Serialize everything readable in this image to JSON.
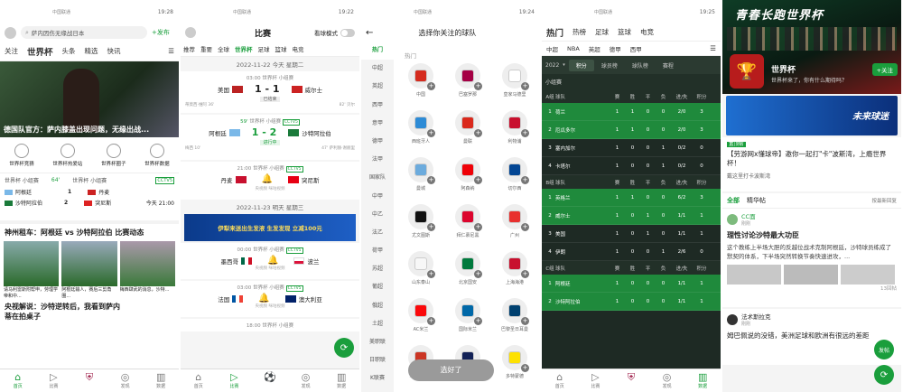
{
  "p1": {
    "carrier": "中国联通",
    "time": "19:28",
    "search": "萨内因伤无缘战日本",
    "publish": "+发布",
    "tabs": [
      "关注",
      "世界杯",
      "头条",
      "精选",
      "快讯"
    ],
    "hero": "德国队官方：萨内膝盖出现问题，无缘出战...",
    "tiles": [
      "世界杯竞猜",
      "世界杯热爱站",
      "世界杯圈子",
      "世界杯数据"
    ],
    "match": {
      "league": "世界杯 小组赛",
      "min": "64'",
      "tv": "CCTV5",
      "t1": "阿根廷",
      "s1": "1",
      "t2": "沙特阿拉伯",
      "s2": "2",
      "league2": "世界杯 小组赛",
      "t3": "丹麦",
      "t4": "突尼斯",
      "day": "今天",
      "kick": "21:00"
    },
    "sec": "神州租车：阿根廷 vs 沙特阿拉伯 比赛动态",
    "cards": [
      "请马利雷斯附帮申，劳理学帝和中...",
      "阿根廷输人，赛后三剪角圈...",
      "梅西肆武的消息，沙特..."
    ],
    "headline": "央视解说：沙特逆转后，我看到萨内蒂在拍桌子",
    "nav": [
      "首页",
      "比赛",
      "",
      "发现",
      "数据"
    ]
  },
  "p2": {
    "carrier": "中国联通",
    "time": "19:22",
    "title": "比赛",
    "toggle": "看球模式",
    "tabs": [
      "世界杯",
      "足球",
      "篮球",
      "电竞"
    ],
    "stabs": [
      "推荐",
      "重要",
      "全球",
      "世界杯",
      "足球",
      "篮球",
      "电竞"
    ],
    "d1": "2022-11-22 今天 星期二",
    "m1": {
      "time": "03:00",
      "league": "世界杯 小组赛",
      "t1": "美国",
      "t2": "威尔士",
      "score": "1 - 1",
      "status": "已结束",
      "n1": "蒂莫西·维阿 36'",
      "n2": "82' 贝尔"
    },
    "m2": {
      "min": "59'",
      "league": "世界杯 小组赛",
      "tv": "CCTV5",
      "t1": "阿根廷",
      "t2": "沙特阿拉伯",
      "score": "1 - 2",
      "status": "进行中",
      "n1": "梅西 10'",
      "n2": "47' 萨利赫·谢赫里"
    },
    "m3": {
      "time": "21:00",
      "league": "世界杯 小组赛",
      "tv": "CCTV5",
      "t1": "丹麦",
      "t2": "突尼斯",
      "sub": "央视频 咪咕视频"
    },
    "d2": "2022-11-23 明天 星期三",
    "ad": "伊犁来送出生发液 生发发现 立减100元",
    "m4": {
      "time": "00:00",
      "league": "世界杯 小组赛",
      "tv": "CCTV5",
      "t1": "墨西哥",
      "t2": "波兰",
      "sub": "央视频 咪咕视频"
    },
    "m5": {
      "time": "03:00",
      "league": "世界杯 小组赛",
      "tv": "CCTV5",
      "t1": "法国",
      "t2": "澳大利亚",
      "sub": "央视频 咪咕视频"
    },
    "m6": {
      "time": "18:00",
      "league": "世界杯 小组赛"
    },
    "nav": [
      "首页",
      "比赛",
      "",
      "发现",
      "数据"
    ]
  },
  "p3": {
    "carrier": "中国联通",
    "time": "19:24",
    "title": "选择你关注的球队",
    "side": [
      "热门",
      "中超",
      "英超",
      "西甲",
      "意甲",
      "德甲",
      "法甲",
      "国家队",
      "中甲",
      "中乙",
      "法乙",
      "荷甲",
      "苏超",
      "葡超",
      "俄超",
      "土超",
      "美职联",
      "日职联",
      "K联赛"
    ],
    "hot": "热门",
    "teams": [
      "中国",
      "巴塞罗那",
      "皇家马德里",
      "西班牙人",
      "曼联",
      "利物浦",
      "曼城",
      "阿森纳",
      "切尔西",
      "尤文图斯",
      "拜仁慕尼黑",
      "广州",
      "山东泰山",
      "北京国安",
      "上海海港",
      "AC米兰",
      "国际米兰",
      "巴黎圣日耳曼",
      "马德里竞技",
      "托特纳姆热刺",
      "多特蒙德"
    ],
    "btn": "选好了"
  },
  "p4": {
    "carrier": "中国联通",
    "time": "19:25",
    "tabs": [
      "热门",
      "热榜",
      "足球",
      "篮球",
      "电竞"
    ],
    "stabs": [
      "中超",
      "NBA",
      "英超",
      "德甲",
      "西甲"
    ],
    "year": "2022",
    "seg": [
      "积分",
      "球员榜",
      "球队榜",
      "赛程"
    ],
    "stage": "小组赛",
    "head": [
      "球队",
      "赛",
      "胜",
      "平",
      "负",
      "进/失",
      "积分"
    ],
    "groups": [
      {
        "name": "A组",
        "rows": [
          [
            "1",
            "荷兰",
            "1",
            "1",
            "0",
            "0",
            "2/0",
            "3"
          ],
          [
            "2",
            "厄瓜多尔",
            "1",
            "1",
            "0",
            "0",
            "2/0",
            "3"
          ],
          [
            "3",
            "塞内加尔",
            "1",
            "0",
            "0",
            "1",
            "0/2",
            "0"
          ],
          [
            "4",
            "卡塔尔",
            "1",
            "0",
            "0",
            "1",
            "0/2",
            "0"
          ]
        ]
      },
      {
        "name": "B组",
        "rows": [
          [
            "1",
            "英格兰",
            "1",
            "1",
            "0",
            "0",
            "6/2",
            "3"
          ],
          [
            "2",
            "威尔士",
            "1",
            "0",
            "1",
            "0",
            "1/1",
            "1"
          ],
          [
            "3",
            "美国",
            "1",
            "0",
            "1",
            "0",
            "1/1",
            "1"
          ],
          [
            "4",
            "伊朗",
            "1",
            "0",
            "0",
            "1",
            "2/6",
            "0"
          ]
        ]
      },
      {
        "name": "C组",
        "rows": [
          [
            "1",
            "阿根廷",
            "1",
            "0",
            "0",
            "0",
            "1/1",
            "1"
          ],
          [
            "2",
            "沙特阿拉伯",
            "1",
            "0",
            "0",
            "0",
            "1/1",
            "1"
          ]
        ]
      }
    ],
    "nav": [
      "首页",
      "比赛",
      "",
      "发现",
      "数据"
    ]
  },
  "p5": {
    "banner": "青春长跑世界杯",
    "circle": "世界杯",
    "sub": "世界杯来了，你有什么期待吗？",
    "follow": "+关注",
    "promo": "未来球迷",
    "pin": "置顶帖",
    "post": "【劳游网x懂球帝】邀你一起打\"卡\"波斯湾，上瘾世界杯！",
    "post2": "戴这里打卡波斯湾",
    "tabs": [
      "全部",
      "精华帖"
    ],
    "sort": "按最新回复",
    "u1": "CC面",
    "t1": "刚刚",
    "h1": "理性讨论沙特最大功臣",
    "b1": "这个教练上半场大胆的反越位战术克制阿根廷，沙特球员练成了默契的体系，下半场突然转换节奏快速进攻，...",
    "c1": "13回帖",
    "u2": "法术斯拉克",
    "t2": "刚刚",
    "b2": "姆巴佩说的没错，美洲足球和欧洲有很远的差距",
    "fab": "发帖"
  }
}
